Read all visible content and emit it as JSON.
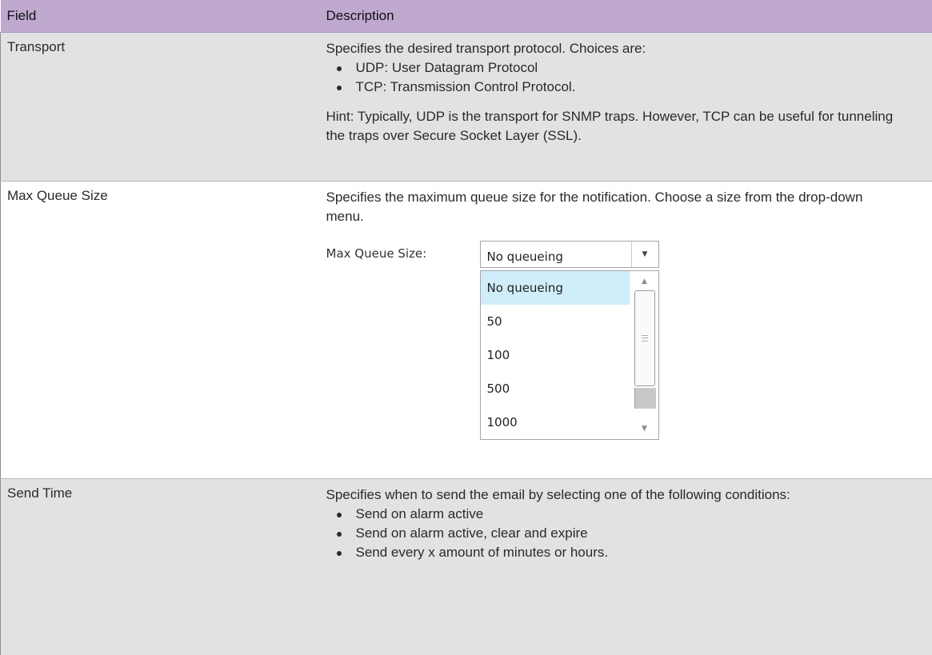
{
  "table": {
    "header": {
      "field": "Field",
      "description": "Description"
    },
    "rows": [
      {
        "field": "Transport",
        "intro": "Specifies the desired transport protocol. Choices are:",
        "bullets": [
          "UDP: User Datagram Protocol",
          "TCP: Transmission Control Protocol."
        ],
        "hint": "Hint: Typically, UDP is the transport for SNMP traps. However, TCP can be useful for tunneling the traps over Secure Socket Layer (SSL)."
      },
      {
        "field": "Max Queue Size",
        "intro": "Specifies the maximum queue size for the notification. Choose a size from the drop-down menu.",
        "widget": {
          "label": "Max Queue Size:",
          "selected": "No queueing",
          "options": [
            "No queueing",
            "50",
            "100",
            "500",
            "1000"
          ]
        }
      },
      {
        "field": "Send Time",
        "intro": "Specifies when to send the email by selecting one of the following conditions:",
        "bullets": [
          "Send on alarm active",
          "Send on alarm active, clear and expire",
          "Send every x amount of minutes or hours."
        ]
      }
    ]
  },
  "colors": {
    "header_bg": "#bfa9cf",
    "shaded_row": "#e2e2e2",
    "selected_option": "#cfeefa"
  },
  "icons": {
    "select_arrow": "chevron-down-icon",
    "scroll_up": "scroll-up-icon",
    "scroll_down": "scroll-down-icon"
  }
}
